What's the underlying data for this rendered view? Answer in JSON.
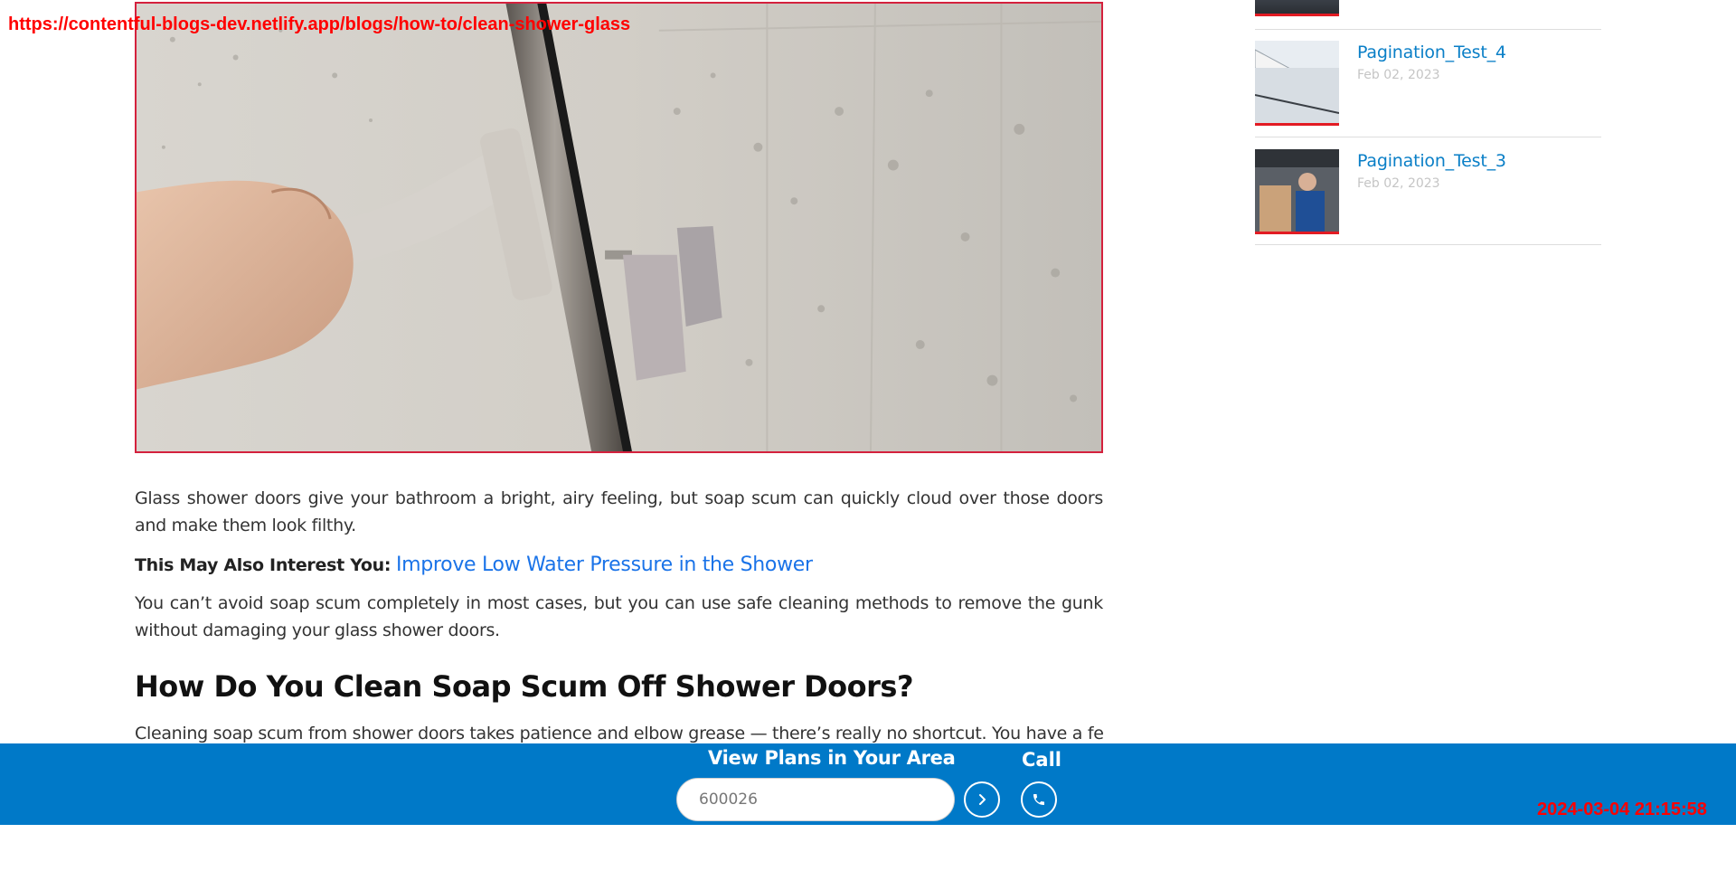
{
  "overlay": {
    "url": "https://contentful-blogs-dev.netlify.app/blogs/how-to/clean-shower-glass",
    "timestamp": "2024-03-04 21:15:58"
  },
  "article": {
    "hero_alt": "Hand using a squeegee on a wet glass shower door",
    "paragraph1": "Glass shower doors give your bathroom a bright, airy feeling, but soap scum can quickly cloud over those doors and make them look filthy.",
    "interest_label": "This May Also Interest You:",
    "interest_link": "Improve Low Water Pressure in the Shower",
    "paragraph2": "You can’t avoid soap scum completely in most cases, but you can use safe cleaning methods to remove the gunk without damaging your glass shower doors.",
    "heading": "How Do You Clean Soap Scum Off Shower Doors?",
    "paragraph3": "Cleaning soap scum from shower doors takes patience and elbow grease — there’s really no shortcut. You have a few"
  },
  "sidebar": {
    "items": [
      {
        "title": "Pagination_Test_4",
        "date": "Feb 02, 2023"
      },
      {
        "title": "Pagination_Test_3",
        "date": "Feb 02, 2023"
      }
    ]
  },
  "bottom_bar": {
    "title": "View Plans in Your Area",
    "zip_value": "600026",
    "call_label": "Call",
    "colors": {
      "background": "#0079c8",
      "text": "#ffffff"
    }
  },
  "colors": {
    "accent_red": "#e21b23",
    "link_blue": "#1a73e8",
    "sidebar_title_blue": "#0a7fc7"
  },
  "icons": {
    "go": "chevron-right-icon",
    "call": "phone-icon"
  }
}
